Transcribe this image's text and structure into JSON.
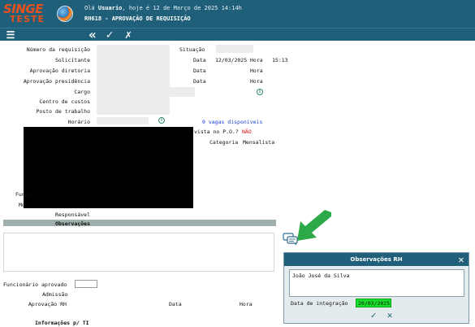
{
  "header": {
    "logo_top": "SINGE",
    "logo_bottom": "TESTE",
    "greeting_prefix": "Olá",
    "user": "Usuario",
    "greeting_suffix": ", hoje é 12 de Março de 2025 14:14h",
    "screen_title": "RH618 - APROVAÇÃO DE REQUISIÇÃO"
  },
  "toolbar": {
    "menu_icon": "☰",
    "back_icon": "«",
    "confirm_icon": "✓",
    "cancel_icon": "✗"
  },
  "form": {
    "numero_label": "Número da requisição",
    "situacao_label": "Situação",
    "solicitante_label": "Solicitante",
    "data_label": "Data",
    "data_value": "12/03/2025",
    "hora_label": "Hora",
    "hora_value": "15:13",
    "aprov_diretoria_label": "Aprovação diretoria",
    "aprov_presidencia_label": "Aprovação presidência",
    "cargo_label": "Cargo",
    "centro_custos_label": "Centro de custos",
    "posto_label": "Posto de trabalho",
    "horario_label": "Horário",
    "vagas": "0 vagas disponíveis",
    "prevista_label": "vista no P.O.?",
    "prevista_value": "NÃO",
    "categoria_label": "Categoria",
    "categoria_value": "Mensalista",
    "func_partial": "Funci",
    "mo_partial": "Mo",
    "responsavel_label": "Responsável",
    "observacoes_label": "Observações",
    "func_aprovado_label": "Funcionário aprovado",
    "admissao_label": "Admissão",
    "aprov_rh_label": "Aprovação RH",
    "data2_label": "Data",
    "hora2_label": "Hora",
    "info_ti_label": "Informações p/ TI"
  },
  "popup": {
    "title": "Observações RH",
    "close": "✕",
    "textarea_value": "João José da Silva",
    "date_label": "Data de integração",
    "date_value": "20/03/2025",
    "ok": "✓",
    "cancel": "✕"
  },
  "colors": {
    "header_bg": "#1f5f79",
    "logo": "#e9511c",
    "highlight": "#19e02a",
    "arrow": "#2ea94a"
  }
}
